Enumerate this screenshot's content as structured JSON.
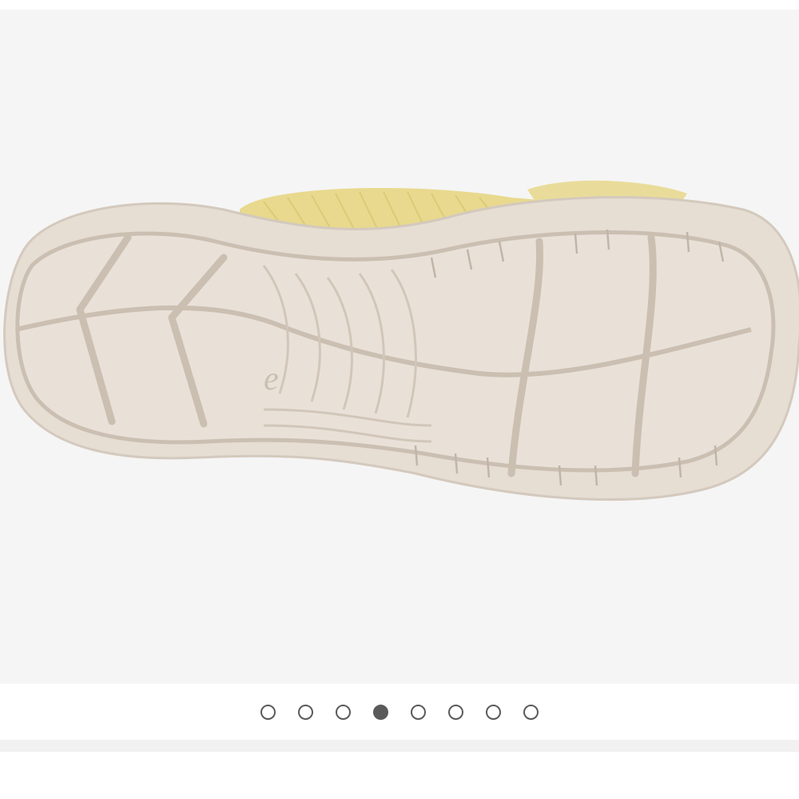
{
  "product_image": {
    "alt": "",
    "icon": "sandal-sole-image"
  },
  "carousel": {
    "count": 8,
    "active_index": 3
  },
  "colors": {
    "background": "#f5f5f5",
    "sole": "#e6ddd3",
    "tread_line": "#cbbfb2",
    "strap": "#e8d98e",
    "dot": "#5a5a5a"
  }
}
